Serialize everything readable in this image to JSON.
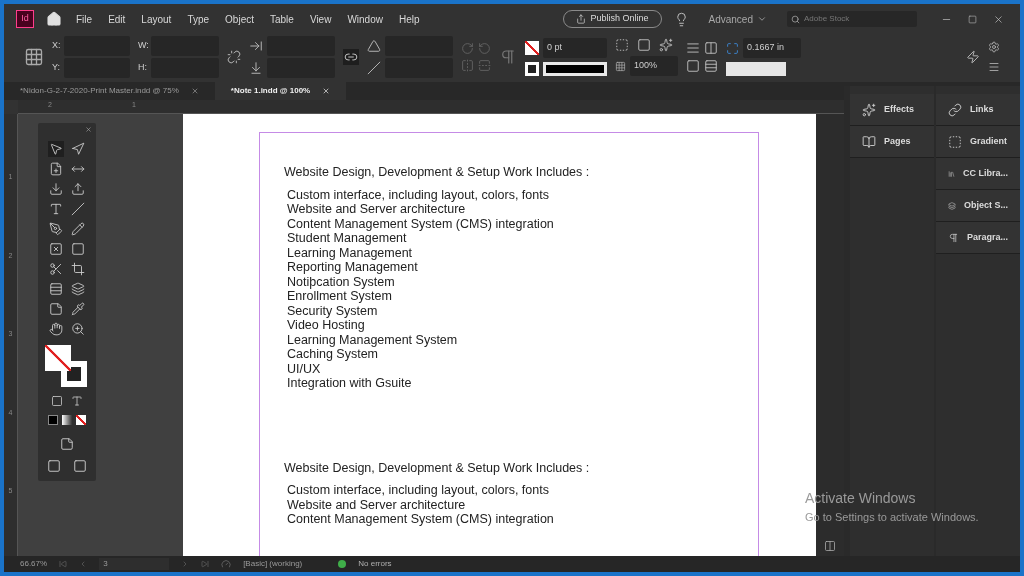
{
  "app": {
    "logo": "Id"
  },
  "menu": [
    "File",
    "Edit",
    "Layout",
    "Type",
    "Object",
    "Table",
    "View",
    "Window",
    "Help"
  ],
  "header": {
    "publish": "Publish Online",
    "workspace": "Advanced",
    "search_placeholder": "Adobe Stock"
  },
  "control_bar": {
    "x_label": "X:",
    "y_label": "Y:",
    "w_label": "W:",
    "h_label": "H:",
    "stroke_weight": "0 pt",
    "opacity": "100%",
    "spacing": "0.1667 in"
  },
  "tabs": [
    {
      "label": "*Nidon-G-2-7-2020-Print Master.indd @ 75%",
      "selected": false
    },
    {
      "label": "*Note 1.indd @ 100%",
      "selected": true
    }
  ],
  "rulers": {
    "horizontal": [
      "2",
      "1"
    ],
    "vertical": [
      "1",
      "2",
      "3",
      "4",
      "5"
    ]
  },
  "document": {
    "blocks": [
      {
        "heading": "Website Design, Development & Setup Work Includes :",
        "items": [
          "Custom interface, including layout, colors, fonts",
          "Website and Server architecture",
          "Content Management System (CMS) integration",
          "Student Management",
          "Learning Management",
          "Reporting Management",
          "Notiþcation System",
          "Enrollment System",
          "Security System",
          "Video Hosting",
          "Learning Management System",
          "Caching System",
          "UI/UX",
          "Integration with Gsuite"
        ]
      },
      {
        "heading": "Website Design, Development & Setup Work Includes :",
        "items": [
          "Custom interface, including layout, colors, fonts",
          "Website and Server architecture",
          "Content Management System (CMS) integration"
        ]
      }
    ]
  },
  "panels": {
    "column_1": [
      {
        "label": "Effects"
      },
      {
        "label": "Pages"
      }
    ],
    "column_2": [
      {
        "label": "Links"
      },
      {
        "label": "Gradient"
      },
      {
        "label": "CC Libra..."
      },
      {
        "label": "Object S..."
      },
      {
        "label": "Paragra..."
      }
    ]
  },
  "status_bar": {
    "zoom": "66.67%",
    "page": "3",
    "preflight_profile": "[Basic] (working)",
    "errors": "No errors"
  },
  "overlay": {
    "title": "Activate Windows",
    "subtitle": "Go to Settings to activate Windows."
  }
}
